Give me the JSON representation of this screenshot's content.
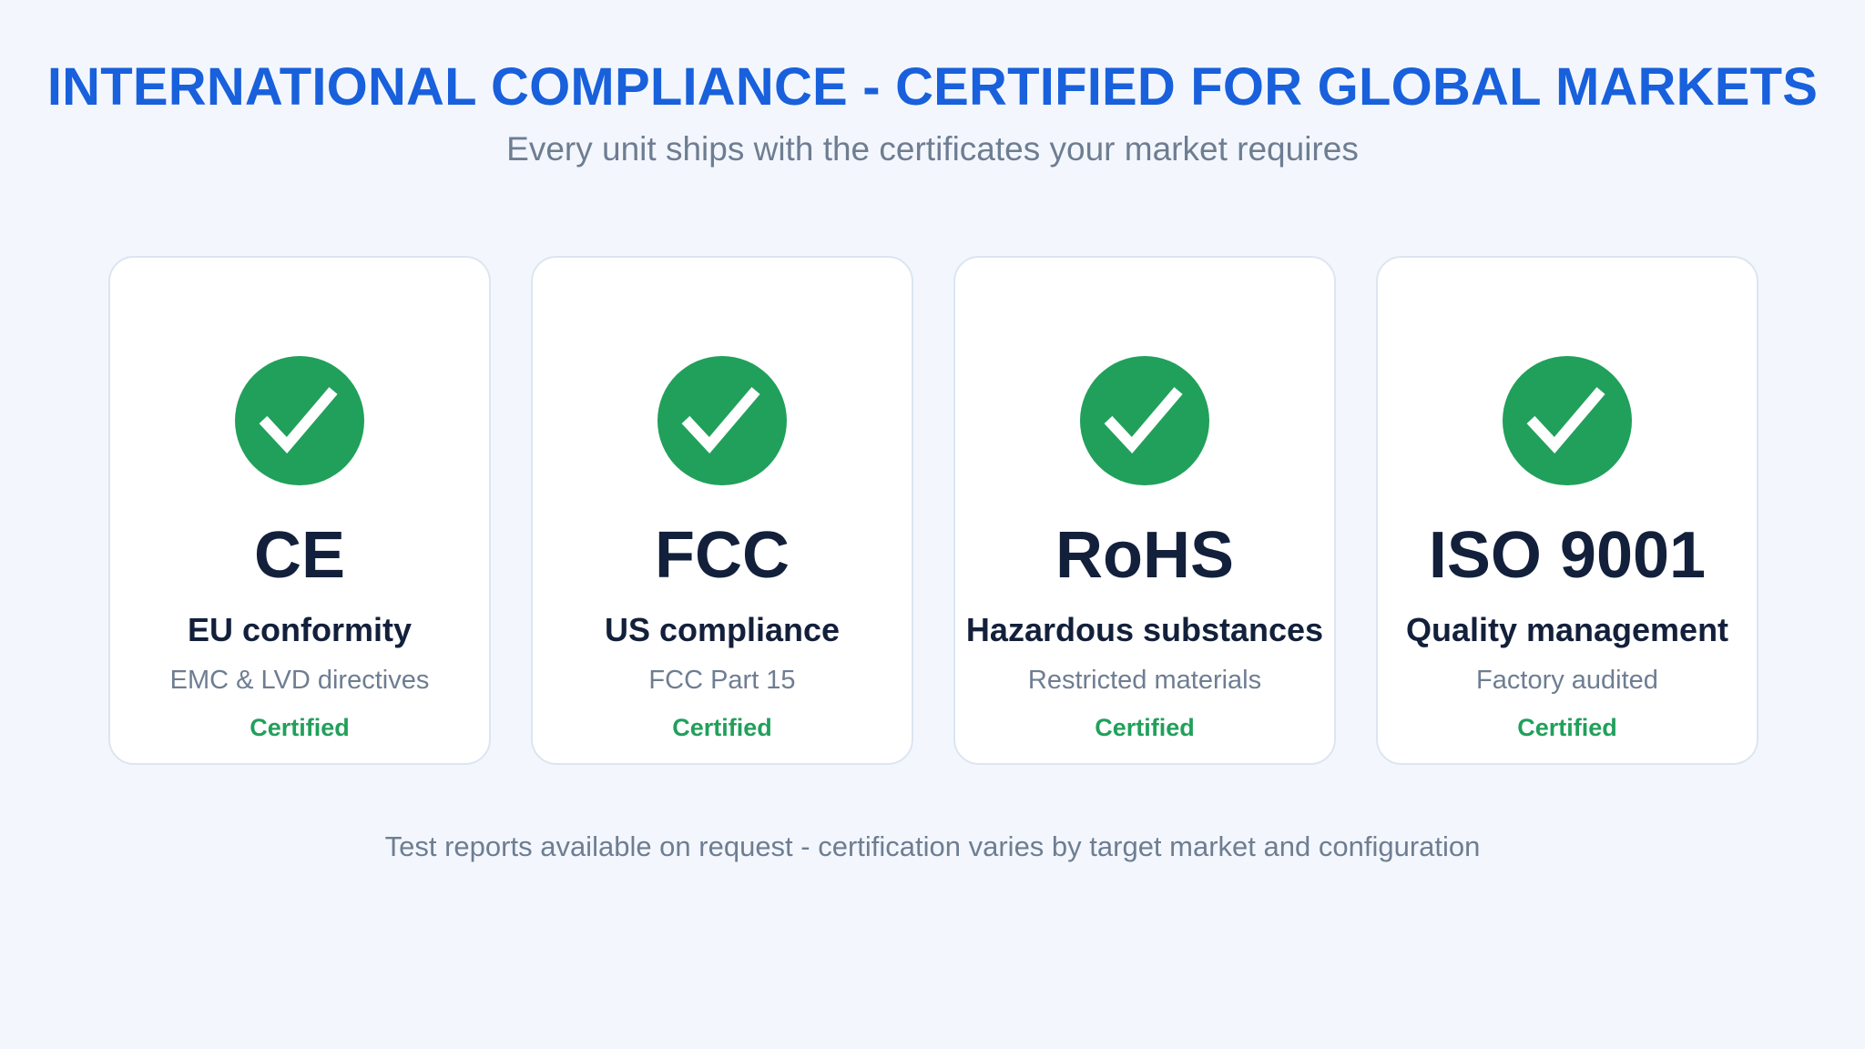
{
  "header": {
    "title": "INTERNATIONAL COMPLIANCE - CERTIFIED FOR GLOBAL MARKETS",
    "subtitle": "Every unit ships with the certificates your market requires"
  },
  "colors": {
    "title": "#1860dc",
    "accent_green": "#21a05b",
    "heading_text": "#13203b",
    "muted_text": "#6e7d92",
    "background": "#f3f7fd",
    "card_background": "#ffffff",
    "card_border": "#dce5f1"
  },
  "certifications": [
    {
      "icon": "check-circle-icon",
      "name": "CE",
      "scope": "EU conformity",
      "detail": "EMC & LVD directives",
      "status": "Certified"
    },
    {
      "icon": "check-circle-icon",
      "name": "FCC",
      "scope": "US compliance",
      "detail": "FCC Part 15",
      "status": "Certified"
    },
    {
      "icon": "check-circle-icon",
      "name": "RoHS",
      "scope": "Hazardous substances",
      "detail": "Restricted materials",
      "status": "Certified"
    },
    {
      "icon": "check-circle-icon",
      "name": "ISO 9001",
      "scope": "Quality management",
      "detail": "Factory audited",
      "status": "Certified"
    }
  ],
  "footer": {
    "note": "Test reports available on request - certification varies by target market and configuration"
  }
}
